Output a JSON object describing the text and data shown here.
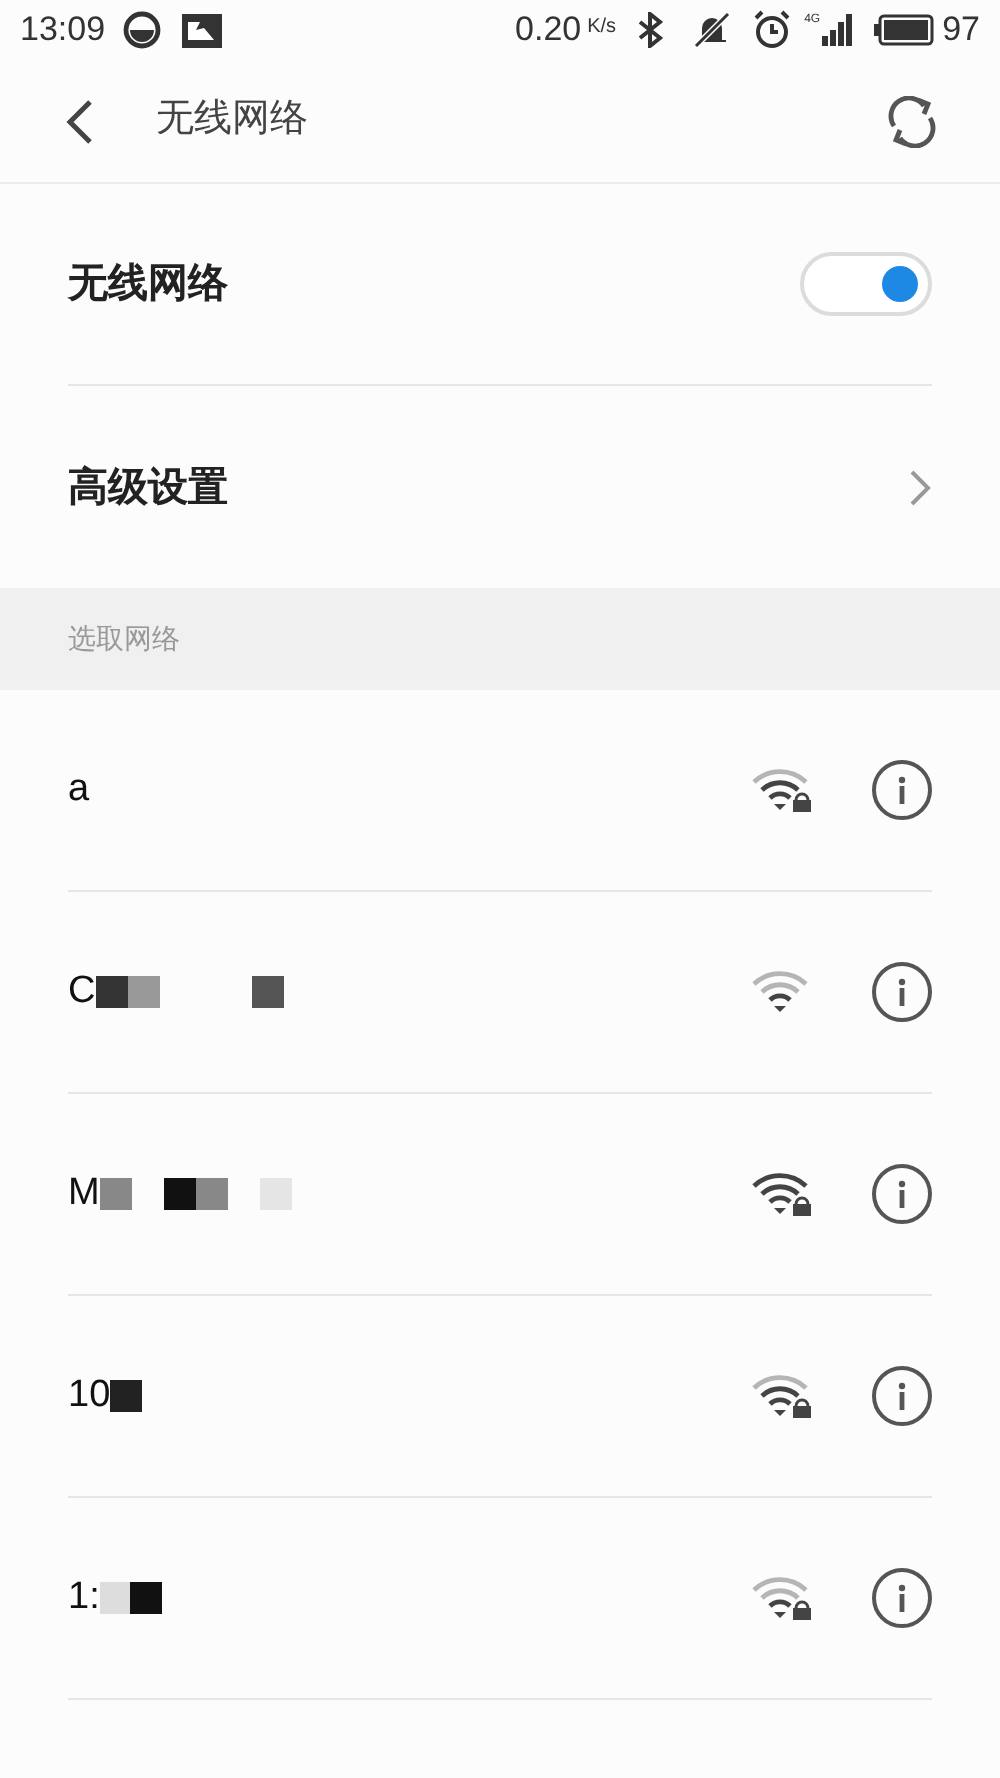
{
  "status_bar": {
    "time": "13:09",
    "speed": "0.20",
    "speed_unit": "K/s",
    "network_type": "4G",
    "battery": "97"
  },
  "header": {
    "title": "无线网络"
  },
  "wifi_switch": {
    "label": "无线网络",
    "on": true
  },
  "advanced": {
    "label": "高级设置"
  },
  "section": {
    "title": "选取网络"
  },
  "networks": [
    {
      "name": "a",
      "locked": true
    },
    {
      "name": "C",
      "locked": false
    },
    {
      "name": "M",
      "locked": true
    },
    {
      "name": "10",
      "locked": true
    },
    {
      "name": "1:",
      "locked": true
    }
  ]
}
